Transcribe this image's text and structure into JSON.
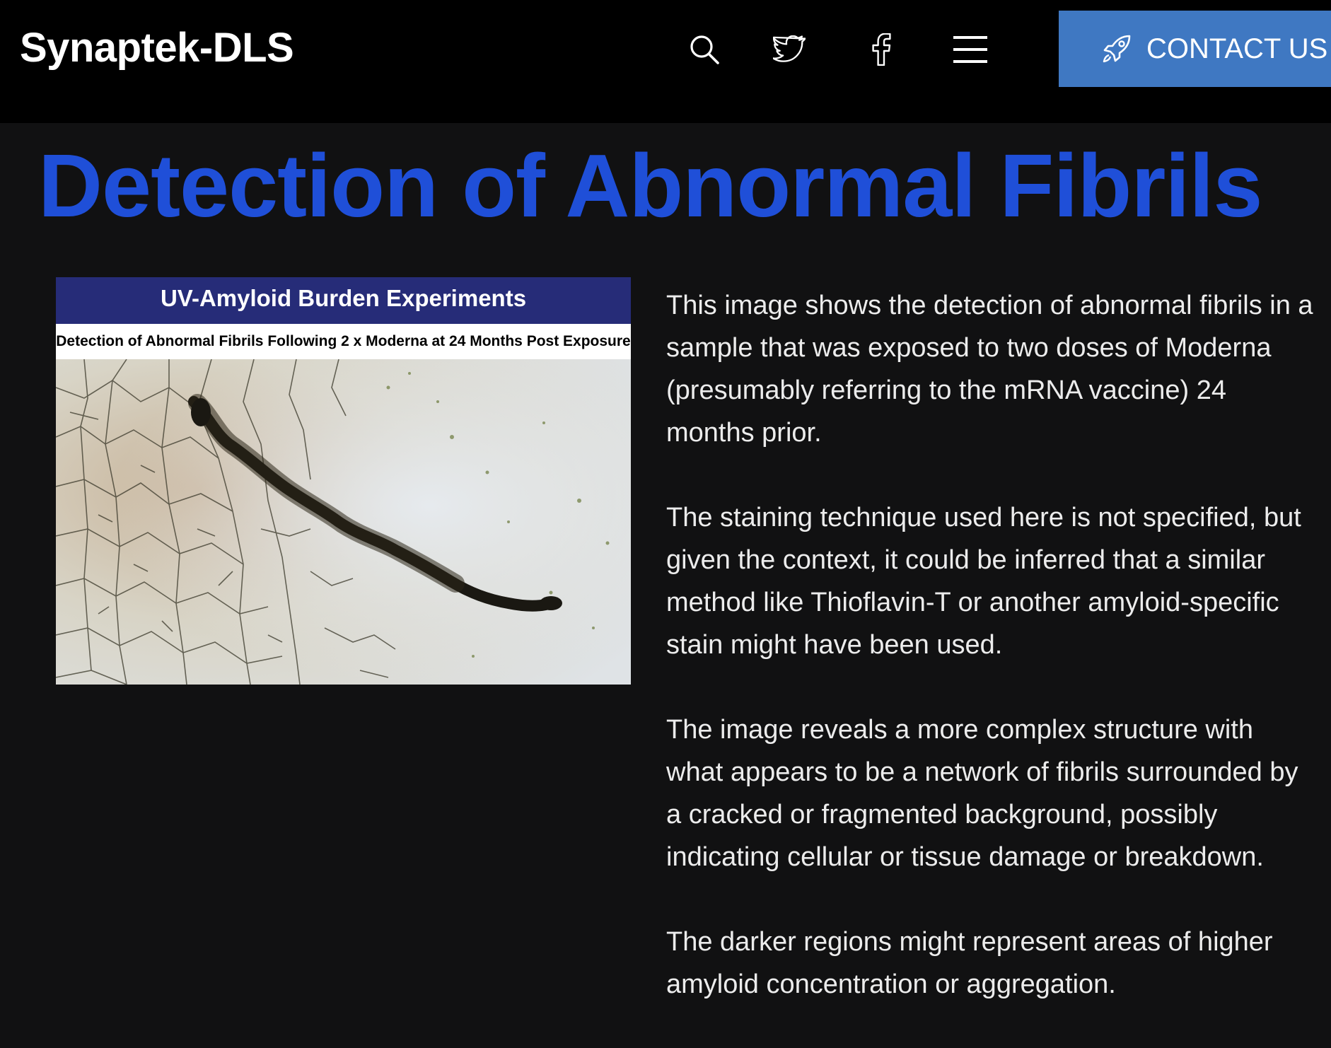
{
  "header": {
    "brand": "Synaptek-DLS",
    "icons": [
      "search-icon",
      "twitter-icon",
      "facebook-icon",
      "menu-icon",
      "rocket-icon"
    ],
    "contact_label": "CONTACT US",
    "accent_color": "#3f78c2"
  },
  "main": {
    "title": "Detection of Abnormal Fibrils",
    "title_color": "#1f4fd8",
    "figure": {
      "banner": "UV-Amyloid Burden Experiments",
      "caption": "Detection of Abnormal Fibrils Following 2 x Moderna at 24 Months Post Exposure"
    },
    "paragraphs": [
      "This image shows the detection of abnormal fibrils in a sample that was exposed to two doses of Moderna (presumably referring to the mRNA vaccine) 24 months prior.",
      "The staining technique used here is not specified, but given the context, it could be inferred that a similar method like Thioflavin-T or another amyloid-specific stain might have been used.",
      "The image reveals a more complex structure with what appears to be a network of fibrils surrounded by a cracked or fragmented background, possibly indicating cellular or tissue damage or breakdown.",
      "The darker regions might represent areas of higher amyloid concentration or aggregation."
    ]
  }
}
